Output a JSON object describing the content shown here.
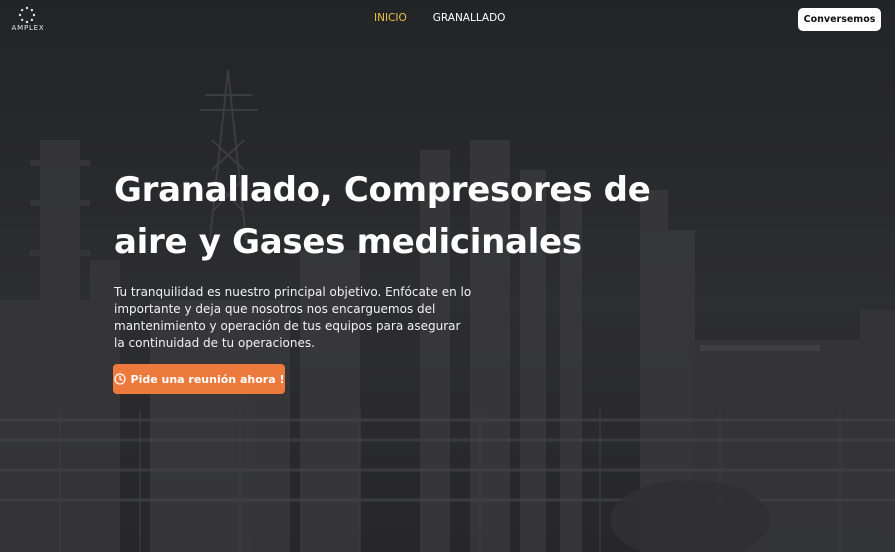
{
  "brand": {
    "logo_text": "AMPLEX"
  },
  "nav": {
    "items": [
      {
        "label": "INICIO",
        "active": true
      },
      {
        "label": "GRANALLADO",
        "active": false
      }
    ]
  },
  "header": {
    "cta_label": "Conversemos"
  },
  "hero": {
    "headline": "Granallado, Compresores de aire y Gases medicinales",
    "subtitle": "Tu tranquilidad es nuestro principal objetivo. Enfócate en lo importante y deja que nosotros nos encarguemos del mantenimiento y operación de tus equipos para asegurar la continuidad de tu operaciones.",
    "cta_label": "Pide una reunión ahora !",
    "cta_icon": "clock-icon"
  },
  "colors": {
    "active_nav": "#e9c24a",
    "cta_main": "#ec7a3c",
    "cta_top_bg": "#ffffff"
  }
}
